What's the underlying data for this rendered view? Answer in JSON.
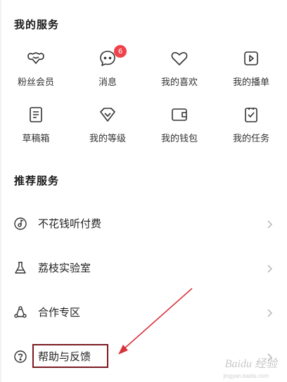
{
  "services": {
    "title": "我的服务",
    "items": [
      {
        "label": "粉丝会员",
        "icon": "fan-membership-icon"
      },
      {
        "label": "消息",
        "icon": "message-icon",
        "badge": "6"
      },
      {
        "label": "我的喜欢",
        "icon": "heart-icon"
      },
      {
        "label": "我的播单",
        "icon": "playlist-icon"
      },
      {
        "label": "草稿箱",
        "icon": "draft-icon"
      },
      {
        "label": "我的等级",
        "icon": "level-icon"
      },
      {
        "label": "我的钱包",
        "icon": "wallet-icon"
      },
      {
        "label": "我的任务",
        "icon": "task-icon"
      }
    ]
  },
  "recommended": {
    "title": "推荐服务",
    "items": [
      {
        "label": "不花钱听付费",
        "icon": "music-disc-icon"
      },
      {
        "label": "荔枝实验室",
        "icon": "flask-icon"
      },
      {
        "label": "合作专区",
        "icon": "cooperation-icon"
      },
      {
        "label": "帮助与反馈",
        "icon": "help-icon"
      }
    ]
  },
  "watermark": {
    "text": "Baidu 经验",
    "sub": "jingyan.baidu.com"
  },
  "colors": {
    "badge": "#f0424a",
    "highlight_border": "#7a1a22",
    "arrow": "#d8323a"
  }
}
